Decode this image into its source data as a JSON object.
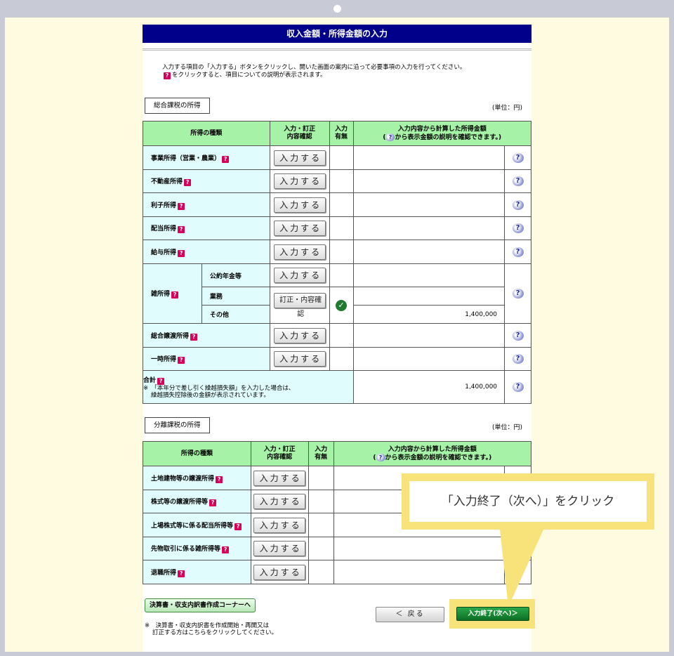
{
  "page": {
    "title": "収入金額・所得金額の入力",
    "instruction_line1": "入力する項目の「入力する」ボタンをクリックし、開いた画面の案内に沿って必要事項の入力を行ってください。",
    "instruction_line2": "をクリックすると、項目についての説明が表示されます。"
  },
  "help_glyph": "?",
  "question_glyph": "?",
  "check_glyph": "✓",
  "unit_label": "(単位：円)",
  "sogo": {
    "section_label": "総合課税の所得",
    "headers": {
      "type": "所得の種類",
      "action_line1": "入力・訂正",
      "action_line2": "内容確認",
      "presence_line1": "入力",
      "presence_line2": "有無",
      "amount_line1": "入力内容から計算した所得金額",
      "amount_line2_pre": "(",
      "amount_line2_post": "から表示金額の説明を確認できます。)"
    },
    "rows": [
      {
        "label": "事業所得（営業・農業）",
        "button": "入力する",
        "amount": ""
      },
      {
        "label": "不動産所得",
        "button": "入力する",
        "amount": ""
      },
      {
        "label": "利子所得",
        "button": "入力する",
        "amount": ""
      },
      {
        "label": "配当所得",
        "button": "入力する",
        "amount": ""
      },
      {
        "label": "給与所得",
        "button": "入力する",
        "amount": ""
      }
    ],
    "zatsu": {
      "label": "雑所得",
      "sub1": "公約年金等",
      "sub1_button": "入力する",
      "sub2": "業務",
      "sub3": "その他",
      "sub23_button": "訂正・内容確認",
      "sub3_amount": "1,400,000"
    },
    "rows2": [
      {
        "label": "総合譲渡所得",
        "button": "入力する"
      },
      {
        "label": "一時所得",
        "button": "入力する"
      }
    ],
    "total": {
      "label": "合計",
      "note_line1": "※　「本年分で差し引く繰越損失額」を入力した場合は、",
      "note_line2": "繰越損失控除後の金額が表示されています。",
      "amount": "1,400,000"
    }
  },
  "bunri": {
    "section_label": "分離課税の所得",
    "rows": [
      {
        "label": "土地建物等の譲渡所得",
        "button": "入力する"
      },
      {
        "label": "株式等の譲渡所得等",
        "button": "入力する"
      },
      {
        "label": "上場株式等に係る配当所得等",
        "button": "入力する"
      },
      {
        "label": "先物取引に係る雑所得等",
        "button": "入力する"
      },
      {
        "label": "退職所得",
        "button": "入力する"
      }
    ]
  },
  "footer": {
    "corner_button": "決算書・収支内訳書作成コーナーへ",
    "note_line1": "※　決算書・収支内訳書を作成開始・再開又は",
    "note_line2": "訂正する方はこちらをクリックしてください。",
    "back_button": "＜ 戻る",
    "next_button": "入力終了(次へ)＞"
  },
  "callout": {
    "text": "「入力終了（次へ）」をクリック"
  }
}
